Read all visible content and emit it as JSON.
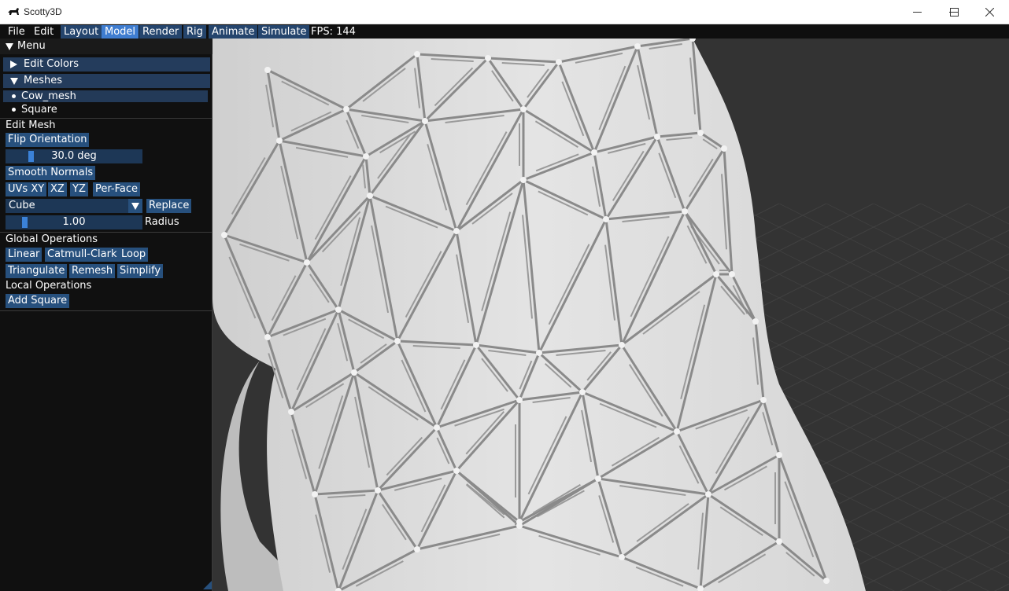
{
  "window": {
    "title": "Scotty3D"
  },
  "menubar": {
    "items": [
      {
        "label": "File",
        "style": "plain"
      },
      {
        "label": "Edit",
        "style": "plain"
      },
      {
        "label": "Layout",
        "style": "tab"
      },
      {
        "label": "Model",
        "style": "active"
      },
      {
        "label": "Render",
        "style": "tab"
      },
      {
        "label": "Rig",
        "style": "tab"
      },
      {
        "label": "Animate",
        "style": "tab"
      },
      {
        "label": "Simulate",
        "style": "tab"
      }
    ],
    "fps": "FPS: 144"
  },
  "panel": {
    "header": "Menu",
    "edit_colors": "Edit Colors",
    "meshes": "Meshes",
    "mesh_list": [
      "Cow_mesh",
      "Square"
    ],
    "edit_mesh_heading": "Edit Mesh",
    "flip_orientation": "Flip Orientation",
    "angle_value": "30.0 deg",
    "angle_fraction": 0.15,
    "smooth_normals": "Smooth Normals",
    "uv_buttons": [
      "UVs XY",
      "XZ",
      "YZ",
      "Per-Face"
    ],
    "shape_selected": "Cube",
    "replace": "Replace",
    "radius_value": "1.00",
    "radius_fraction": 0.1,
    "radius_label": "Radius",
    "global_heading": "Global Operations",
    "global_row1": [
      "Linear",
      "Catmull-Clark",
      "Loop"
    ],
    "global_row2": [
      "Triangulate",
      "Remesh",
      "Simplify"
    ],
    "local_heading": "Local Operations",
    "add_square": "Add Square"
  },
  "colors": {
    "accent": "#3f7dd0",
    "button": "#27507d",
    "panel_bg": "#101010",
    "viewport_bg": "#3a3a3a"
  }
}
